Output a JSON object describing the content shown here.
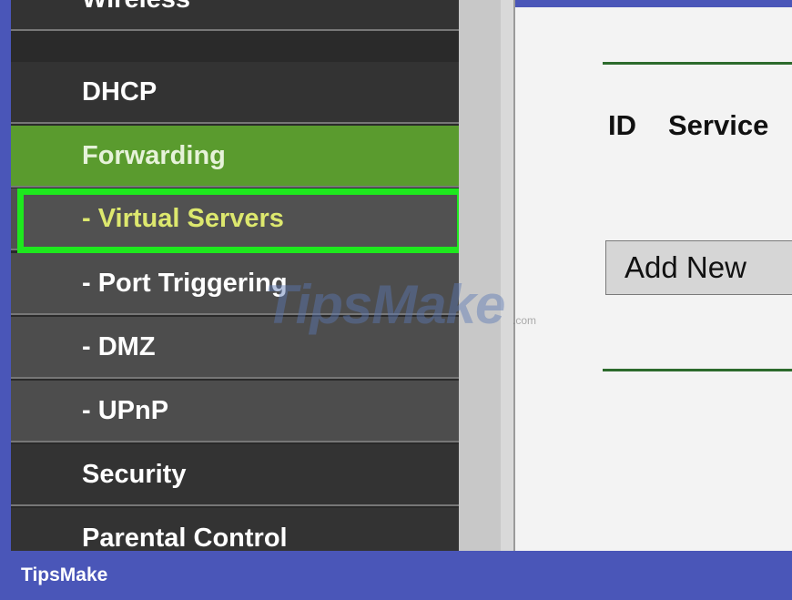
{
  "sidebar": {
    "items": [
      {
        "label": "Wireless"
      },
      {
        "label": "DHCP"
      },
      {
        "label": "Forwarding"
      },
      {
        "label": "- Virtual Servers"
      },
      {
        "label": "- Port Triggering"
      },
      {
        "label": "- DMZ"
      },
      {
        "label": "- UPnP"
      },
      {
        "label": "Security"
      },
      {
        "label": "Parental Control"
      }
    ]
  },
  "main": {
    "columns": {
      "id": "ID",
      "service": "Service"
    },
    "add_button_label": "Add New"
  },
  "watermark": {
    "brand": "TipsMake",
    "suffix": ".com"
  },
  "footer": {
    "brand": "TipsMake"
  },
  "colors": {
    "active_menu": "#5a9b2e",
    "highlight": "#1ee81e",
    "selected_text": "#dde86e",
    "banner": "#4a56b8"
  }
}
